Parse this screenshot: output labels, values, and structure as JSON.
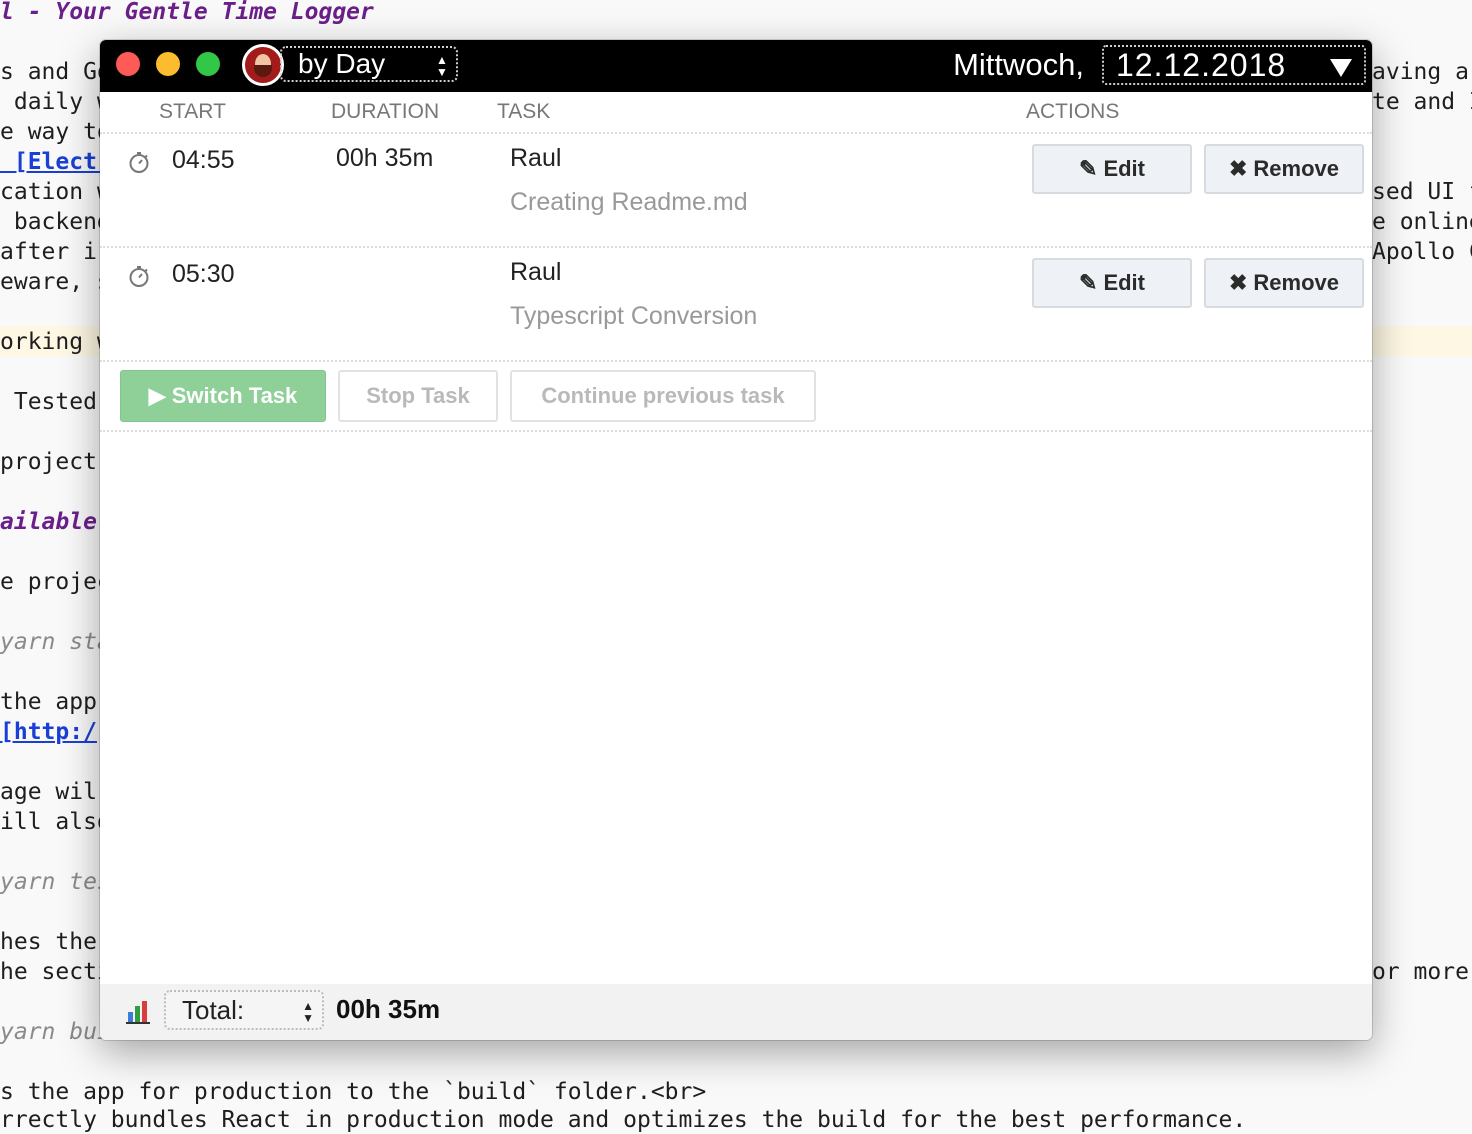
{
  "background_editor": {
    "lines": [
      {
        "text": "l - Your Gentle Time Logger",
        "style": "title"
      },
      {
        "text": "s and Go",
        "style": "plain"
      },
      {
        "text": " daily w",
        "style": "plain"
      },
      {
        "text": "e way to",
        "style": "plain"
      },
      {
        "text": " [Electr",
        "style": "link"
      },
      {
        "text": "cation w",
        "style": "plain"
      },
      {
        "text": " backend",
        "style": "plain"
      },
      {
        "text": "after i",
        "style": "plain"
      },
      {
        "text": "eware, s",
        "style": "plain"
      },
      {
        "text": "orking w",
        "style": "plain"
      },
      {
        "text": " Tested",
        "style": "plain"
      },
      {
        "text": "project",
        "style": "plain"
      },
      {
        "text": "ailable",
        "style": "purple"
      },
      {
        "text": "e projec",
        "style": "plain"
      },
      {
        "text": "yarn sta",
        "style": "cmd"
      },
      {
        "text": "the app",
        "style": "plain"
      },
      {
        "text": "[http:/",
        "style": "link"
      },
      {
        "text": "age wil",
        "style": "plain"
      },
      {
        "text": "ill also",
        "style": "plain"
      },
      {
        "text": "yarn tes",
        "style": "cmd"
      },
      {
        "text": "hes the",
        "style": "plain"
      },
      {
        "text": "he secti",
        "style": "plain"
      },
      {
        "text": "yarn bui",
        "style": "cmd"
      },
      {
        "text": "s the app for production to the `build` folder.<br>",
        "style": "plain"
      },
      {
        "text": "rrectly bundles React in production mode and optimizes the build for the best performance.",
        "style": "plain"
      }
    ],
    "right_lines": [
      {
        "text": "aving a"
      },
      {
        "text": "te and I"
      },
      {
        "text": "sed UI f"
      },
      {
        "text": "e online"
      },
      {
        "text": "Apollo C"
      },
      {
        "text": "or more"
      }
    ]
  },
  "window": {
    "view_select": {
      "value": "by Day"
    },
    "day_label": "Mittwoch,",
    "date_select": {
      "value": "12.12.2018"
    },
    "columns": {
      "start": "START",
      "duration": "DURATION",
      "task": "TASK",
      "actions": "ACTIONS"
    },
    "entries": [
      {
        "start": "04:55",
        "duration": "00h 35m",
        "project": "Raul",
        "description": "Creating Readme.md",
        "edit_label": "Edit",
        "remove_label": "Remove"
      },
      {
        "start": "05:30",
        "duration": "",
        "project": "Raul",
        "description": "Typescript Conversion",
        "edit_label": "Edit",
        "remove_label": "Remove"
      }
    ],
    "controls": {
      "switch_task": "Switch Task",
      "stop_task": "Stop Task",
      "continue_previous": "Continue previous task"
    },
    "footer": {
      "total_select": "Total:",
      "total_value": "00h 35m"
    },
    "icons": {
      "edit": "pencil-icon",
      "remove": "cross-icon",
      "timer": "stopwatch-icon",
      "play": "play-icon",
      "chart": "bar-chart-icon",
      "avatar": "user-avatar"
    },
    "colors": {
      "titlebar": "#000000",
      "switch_button": "#8fcf98",
      "close": "#fc5b57",
      "minimize": "#fdbc2e",
      "maximize": "#33c748"
    }
  }
}
